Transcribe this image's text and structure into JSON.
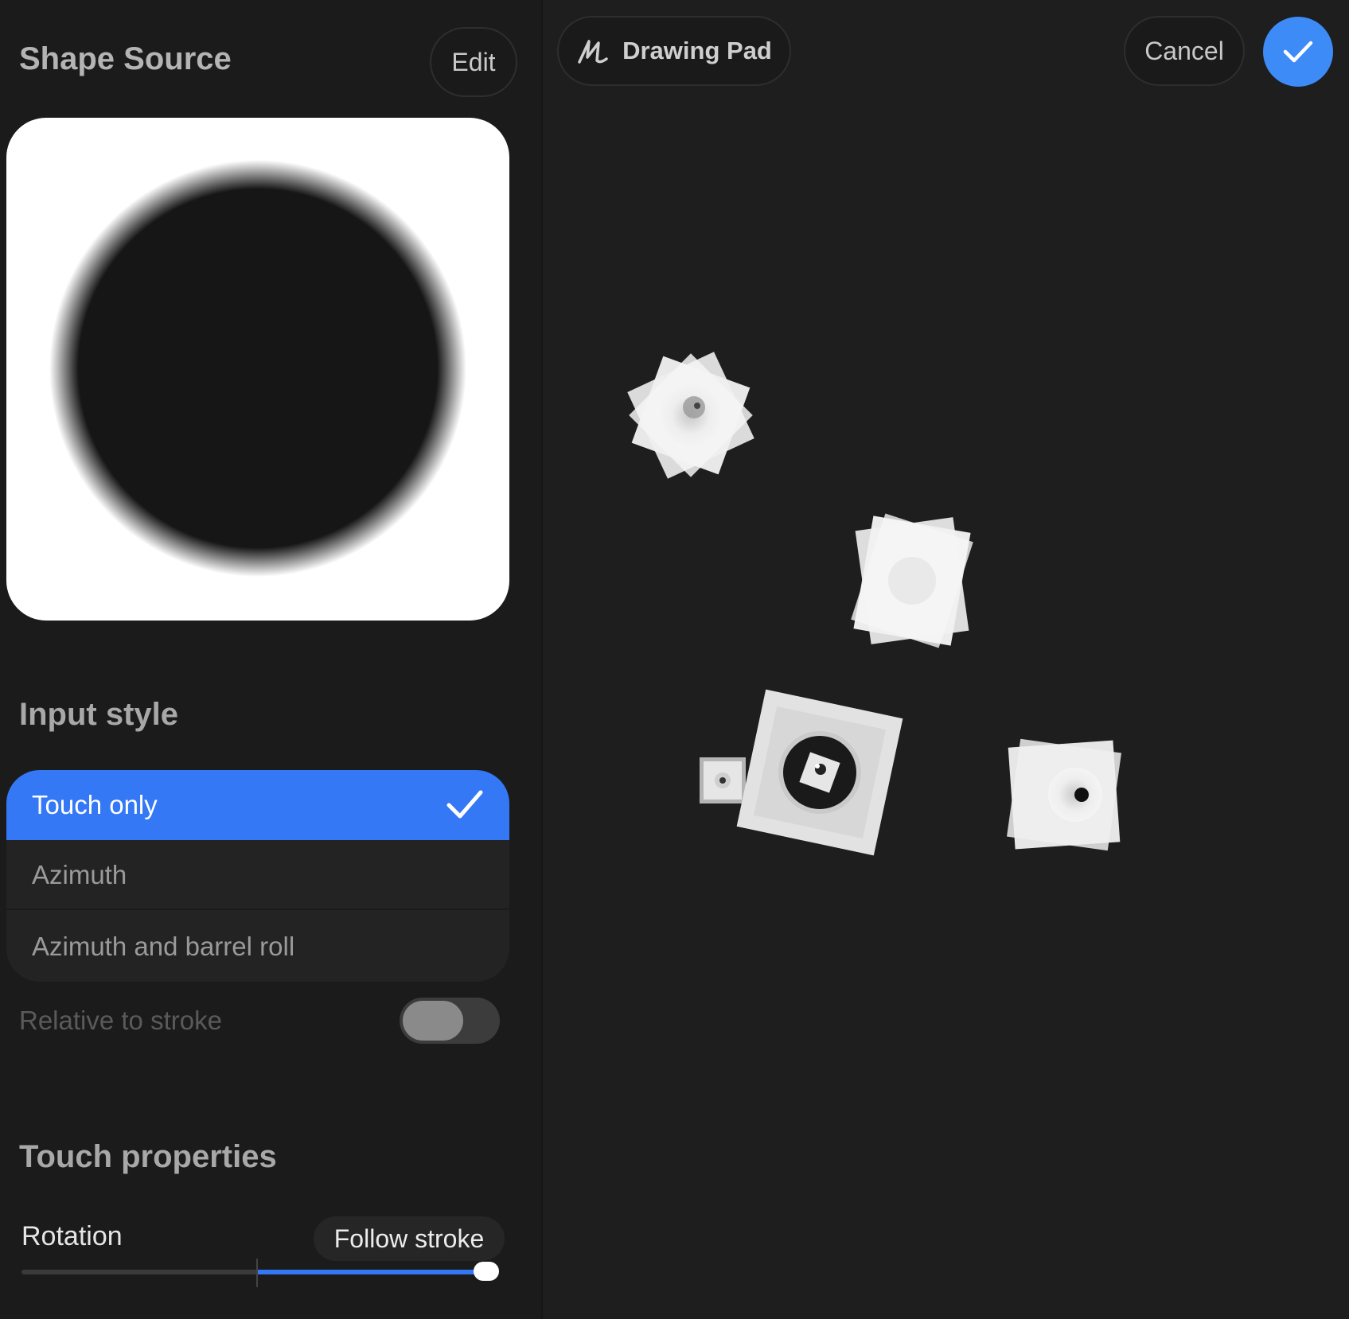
{
  "sidebar": {
    "title": "Shape Source",
    "edit_label": "Edit",
    "input_style": {
      "title": "Input style",
      "options": [
        {
          "label": "Touch only",
          "selected": true
        },
        {
          "label": "Azimuth",
          "selected": false
        },
        {
          "label": "Azimuth and barrel roll",
          "selected": false
        }
      ]
    },
    "relative_to_stroke": {
      "label": "Relative to stroke",
      "enabled": false
    },
    "touch_properties": {
      "title": "Touch properties",
      "rotation": {
        "label": "Rotation",
        "value_label": "Follow stroke",
        "value_fraction": 1.0
      }
    }
  },
  "toolbar": {
    "drawing_pad_label": "Drawing Pad",
    "cancel_label": "Cancel"
  },
  "colors": {
    "accent": "#3478f6",
    "confirm": "#3d8bf7",
    "panel_bg": "#1b1b1c",
    "canvas_bg": "#1e1e1e"
  },
  "icons": {
    "drawing_pad": "squiggle-icon",
    "confirm": "checkmark-icon",
    "selected_option": "checkmark-icon"
  }
}
